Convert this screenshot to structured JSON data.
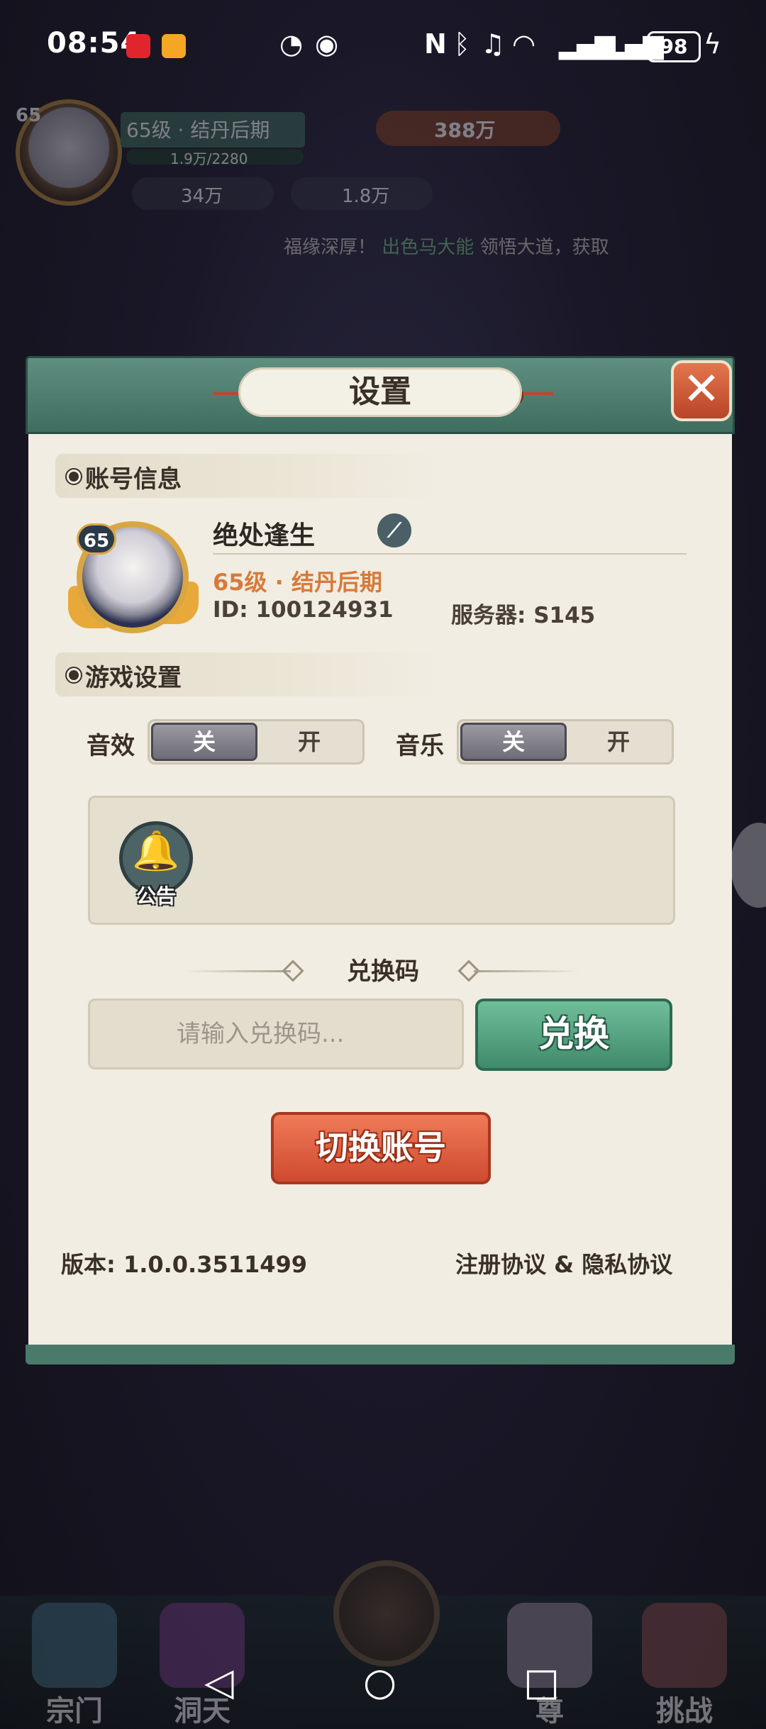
{
  "status_bar": {
    "time": "08:54",
    "battery": "98",
    "icons": [
      "xiaohongshu-app-icon",
      "meituan-app-icon",
      "nfc-lock-icon",
      "eye-icon",
      "nfc-icon",
      "bluetooth-icon",
      "mute-icon",
      "wifi-icon",
      "signal-icon",
      "signal-icon",
      "charging-icon"
    ]
  },
  "hud": {
    "level": "65",
    "name": "65级 · 结丹后期",
    "xp": "1.9万/2280",
    "power": "388万",
    "gems": "34万",
    "coins": "1.8万",
    "ticker_prefix": "福缘深厚！",
    "ticker_name": "出色马大能",
    "ticker_suffix": "领悟大道，获取"
  },
  "dialog": {
    "title": "设置",
    "close_glyph": "✕",
    "account_section": "账号信息",
    "avatar_level": "65",
    "player_name": "绝处逢生",
    "player_level": "65级 · 结丹后期",
    "player_id": "ID: 100124931",
    "server": "服务器: S145",
    "game_section": "游戏设置",
    "sound_label": "音效",
    "music_label": "音乐",
    "toggle_off": "关",
    "toggle_on": "开",
    "notice_label": "公告",
    "redeem_title": "兑换码",
    "redeem_placeholder": "请输入兑换码...",
    "redeem_button": "兑换",
    "switch_account": "切换账号",
    "version": "版本: 1.0.0.3511499",
    "agreements": "注册协议 & 隐私协议"
  },
  "bottom_nav": {
    "items": [
      "宗门",
      "洞天",
      "",
      "尊",
      "挑战"
    ]
  },
  "colors": {
    "header_green": "#4f7f70",
    "panel_bg": "#f1ede2",
    "accent_orange": "#d77a3a",
    "redeem_green": "#4f9e7c",
    "switch_red": "#dd5a3c"
  }
}
